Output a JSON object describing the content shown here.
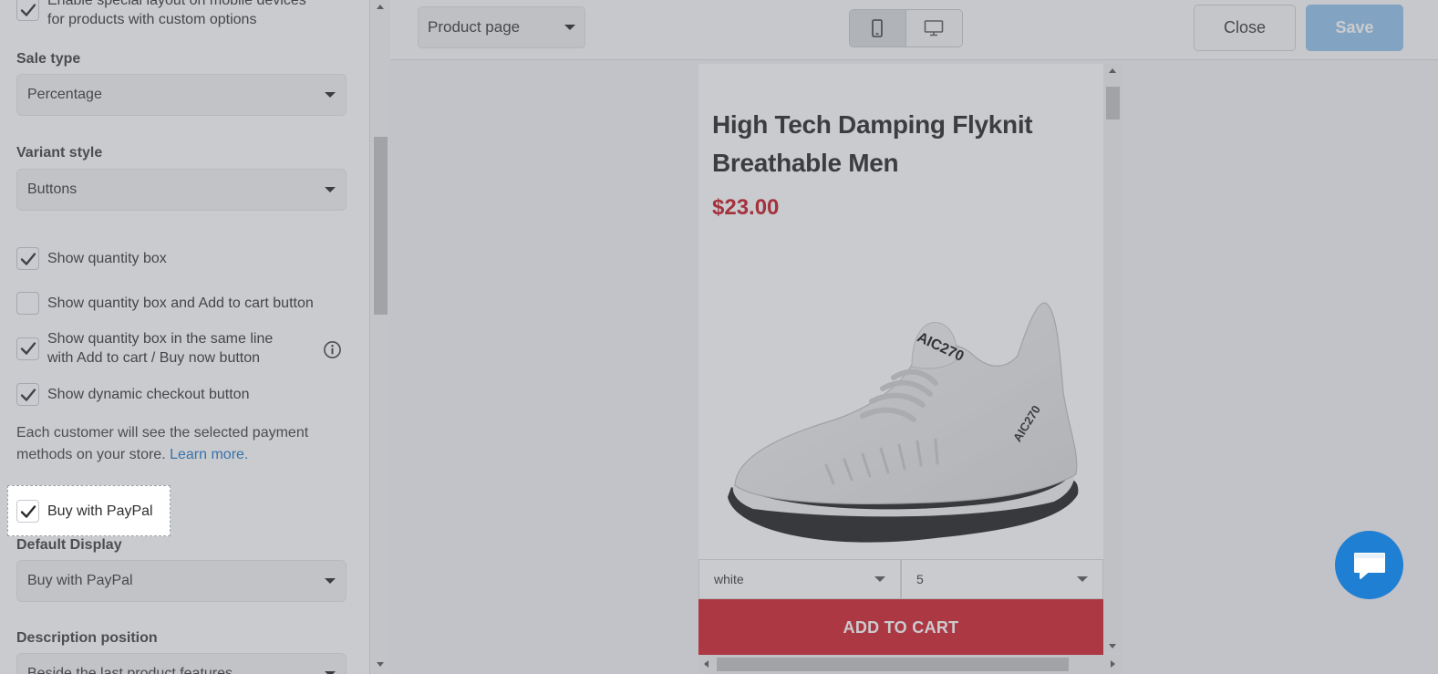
{
  "left_panel": {
    "truncated_option": {
      "line1": "Enable special layout on mobile devices",
      "line2": "for products with custom options",
      "checked": true
    },
    "sale_type": {
      "label": "Sale type",
      "value": "Percentage"
    },
    "variant_style": {
      "label": "Variant style",
      "value": "Buttons"
    },
    "options": [
      {
        "label": "Show quantity box",
        "checked": true
      },
      {
        "label": "Show quantity box and Add to cart button",
        "checked": false
      },
      {
        "label_line1": "Show quantity box in the same line",
        "label_line2": "with Add to cart / Buy now button",
        "checked": true,
        "icon": "info-icon"
      },
      {
        "label": "Show dynamic checkout button",
        "checked": true
      }
    ],
    "help_text": "Each customer will see the selected payment methods on your store.",
    "help_link": "Learn more.",
    "paypal_option": {
      "label": "Buy with PayPal",
      "checked": true
    },
    "default_display": {
      "label": "Default Display",
      "value": "Buy with PayPal"
    },
    "description_position": {
      "label": "Description position",
      "value": "Beside the last product features"
    }
  },
  "toolbar": {
    "page_select": "Product page",
    "device_modes": [
      "mobile-icon",
      "desktop-icon"
    ],
    "active_device": "mobile",
    "close_label": "Close",
    "save_label": "Save"
  },
  "preview": {
    "product_title": "High Tech Damping Flyknit Breathable Men",
    "price": "$23.00",
    "image_text": "AIC270",
    "variant_color": "white",
    "variant_size": "5",
    "add_to_cart_label": "ADD TO CART"
  },
  "colors": {
    "accent_blue": "#1f7fd3",
    "save_button": "#8fc3ec",
    "price_red": "#c2121f",
    "cart_red": "#d11a26",
    "link_blue": "#1a73c9"
  }
}
